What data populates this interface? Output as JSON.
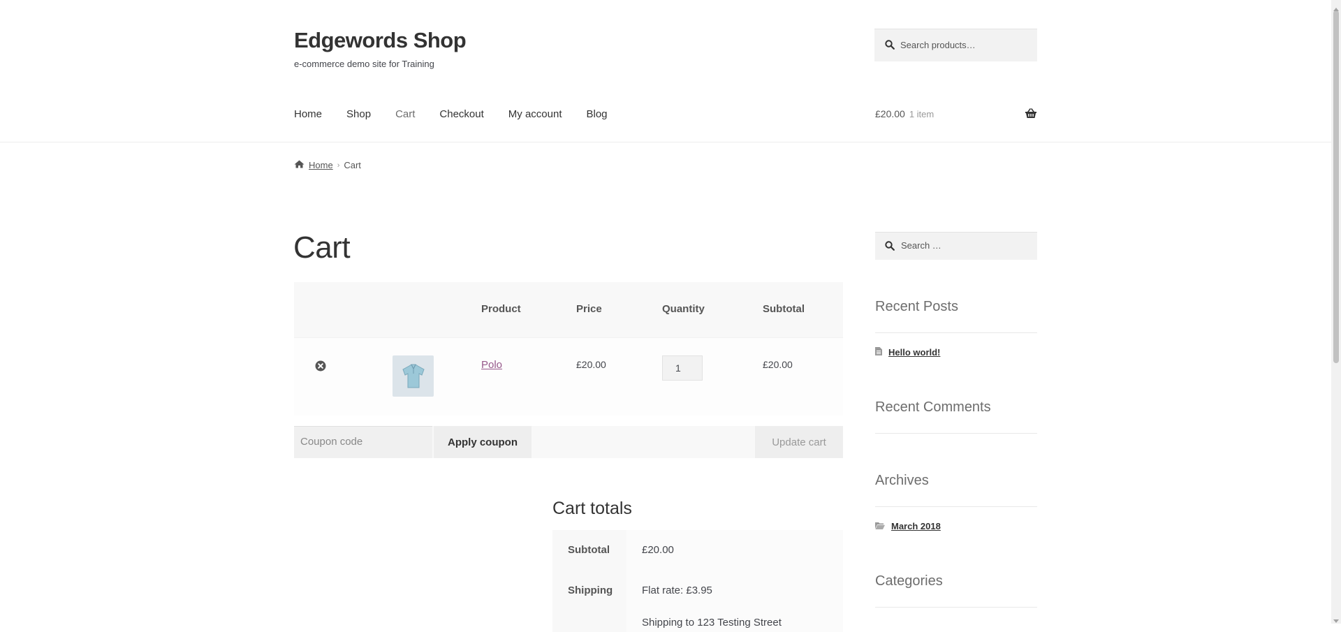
{
  "site": {
    "title": "Edgewords Shop",
    "tagline": "e-commerce demo site for Training"
  },
  "header_search": {
    "placeholder": "Search products…",
    "icon": "search-icon"
  },
  "nav": [
    "Home",
    "Shop",
    "Cart",
    "Checkout",
    "My account",
    "Blog"
  ],
  "nav_current": "Cart",
  "mini_cart": {
    "amount": "£20.00",
    "count": "1 item",
    "icon": "basket-icon"
  },
  "breadcrumb": {
    "home": "Home",
    "current": "Cart",
    "icon": "home-icon"
  },
  "page_title": "Cart",
  "cart_table": {
    "headers": {
      "product": "Product",
      "price": "Price",
      "quantity": "Quantity",
      "subtotal": "Subtotal"
    },
    "items": [
      {
        "product": "Polo",
        "price": "£20.00",
        "quantity": "1",
        "subtotal": "£20.00"
      }
    ]
  },
  "actions": {
    "coupon_placeholder": "Coupon code",
    "apply_label": "Apply coupon",
    "update_label": "Update cart"
  },
  "totals": {
    "title": "Cart totals",
    "subtotal_label": "Subtotal",
    "subtotal_value": "£20.00",
    "shipping_label": "Shipping",
    "shipping_value": "Flat rate: £3.95",
    "shipping_note": "Shipping to 123 Testing Street"
  },
  "sidebar": {
    "search_placeholder": "Search …",
    "recent_posts_title": "Recent Posts",
    "recent_posts": [
      "Hello world!"
    ],
    "recent_comments_title": "Recent Comments",
    "archives_title": "Archives",
    "archives": [
      "March 2018"
    ],
    "categories_title": "Categories"
  },
  "colors": {
    "link_purple": "#96588a",
    "text": "#43454b",
    "muted": "#6d6d6d",
    "panel": "#f8f8f8"
  }
}
